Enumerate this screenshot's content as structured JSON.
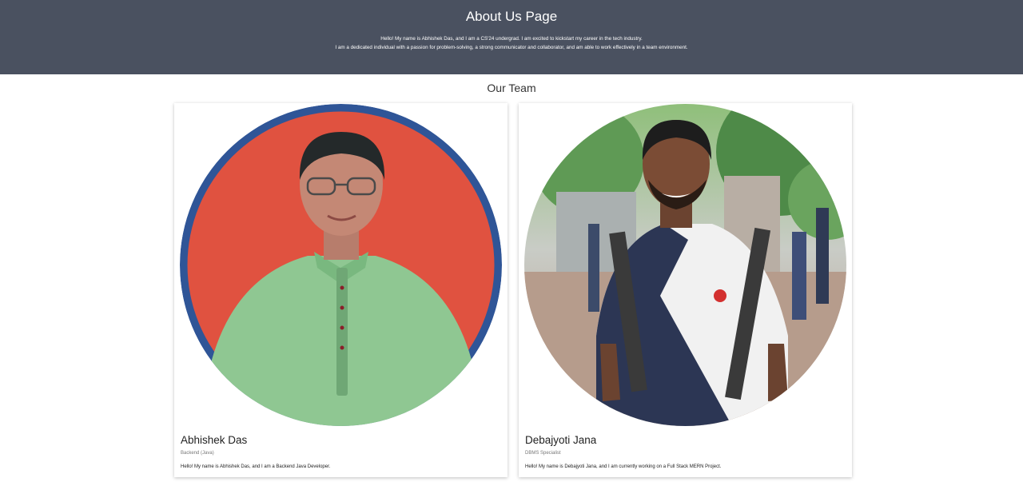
{
  "header": {
    "title": "About Us Page",
    "intro_line_1": "Hello! My name is Abhishek Das, and I am a CS'24 undergrad. I am excited to kickstart my career in the tech industry.",
    "intro_line_2": "I am a dedicated individual with a passion for problem-solving, a strong communicator and collaborator, and am able to work effectively in a team environment."
  },
  "team": {
    "heading": "Our Team",
    "members": [
      {
        "name": "Abhishek Das",
        "role": "Backend (Java)",
        "bio": "Hello! My name is Abhishek Das, and I am a Backend Java Developer."
      },
      {
        "name": "Debajyoti Jana",
        "role": "DBMS Specialist",
        "bio": "Hello! My name is Debajyoti Jana, and I am currently working on a Full Stack MERN Project."
      }
    ]
  },
  "colors": {
    "header_bg": "#4a5160",
    "avatar_1_bg": "#e05240",
    "avatar_1_ring": "#2f5597"
  }
}
